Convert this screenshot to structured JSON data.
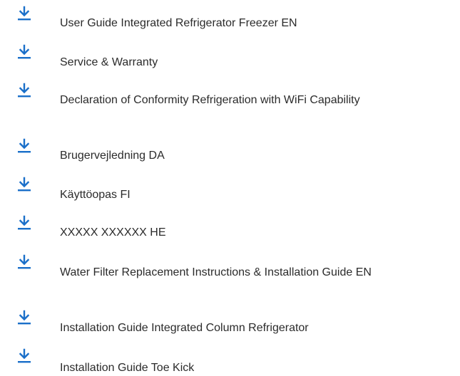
{
  "accent_color": "#1a6fc9",
  "icon": "download-arrow-icon",
  "documents": [
    {
      "label": "User Guide Integrated Refrigerator Freezer EN"
    },
    {
      "label": "Service & Warranty"
    },
    {
      "label": "Declaration of Conformity Refrigeration with WiFi Capability"
    },
    {
      "label": "Brugervejledning DA"
    },
    {
      "label": "Käyttöopas FI"
    },
    {
      "label": "XXXXX XXXXXX HE"
    },
    {
      "label": "Water Filter Replacement Instructions & Installation Guide EN"
    },
    {
      "label": "Installation Guide Integrated Column Refrigerator"
    },
    {
      "label": "Installation Guide Toe Kick"
    }
  ]
}
